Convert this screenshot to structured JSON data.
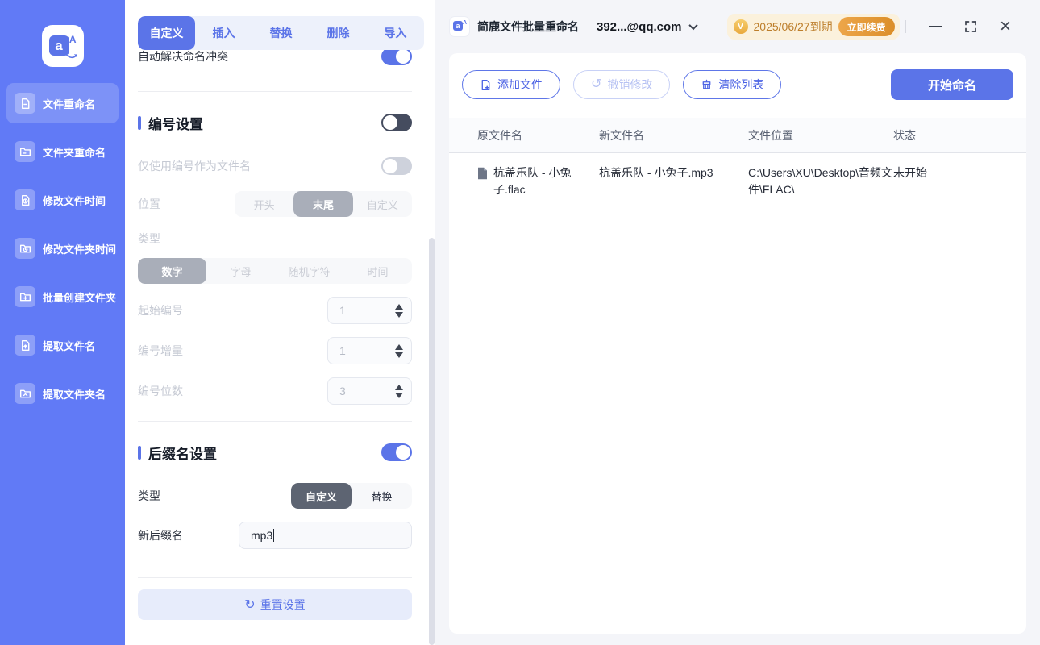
{
  "sidebar": {
    "items": [
      {
        "label": "文件重命名"
      },
      {
        "label": "文件夹重命名"
      },
      {
        "label": "修改文件时间"
      },
      {
        "label": "修改文件夹时间"
      },
      {
        "label": "批量创建文件夹"
      },
      {
        "label": "提取文件名"
      },
      {
        "label": "提取文件夹名"
      }
    ]
  },
  "tabs": [
    "自定义",
    "插入",
    "替换",
    "删除",
    "导入"
  ],
  "settings": {
    "conflict_label": "自动解决命名冲突",
    "conflict_on": true,
    "numbering": {
      "title": "编号设置",
      "enabled": false,
      "only_number_label": "仅使用编号作为文件名",
      "only_number_on": false,
      "position_label": "位置",
      "position_options": [
        "开头",
        "末尾",
        "自定义"
      ],
      "position_selected": "末尾",
      "type_label": "类型",
      "type_options": [
        "数字",
        "字母",
        "随机字符",
        "时间"
      ],
      "type_selected": "数字",
      "start_label": "起始编号",
      "start_value": "1",
      "increment_label": "编号增量",
      "increment_value": "1",
      "digits_label": "编号位数",
      "digits_value": "3"
    },
    "suffix": {
      "title": "后缀名设置",
      "enabled": true,
      "type_label": "类型",
      "type_options": [
        "自定义",
        "替换"
      ],
      "type_selected": "自定义",
      "new_suffix_label": "新后缀名",
      "new_suffix_value": "mp3"
    },
    "reset_label": "重置设置"
  },
  "titlebar": {
    "app_title": "简鹿文件批量重命名",
    "account": "392...@qq.com",
    "license_expiry": "2025/06/27到期",
    "renew_label": "立即续费"
  },
  "toolbar": {
    "add_files": "添加文件",
    "undo": "撤销修改",
    "clear_list": "清除列表",
    "start": "开始命名"
  },
  "table": {
    "headers": [
      "原文件名",
      "新文件名",
      "文件位置",
      "状态"
    ],
    "rows": [
      {
        "original": "杭盖乐队 - 小兔子.flac",
        "new_name": "杭盖乐队 - 小兔子.mp3",
        "location": "C:\\Users\\XU\\Desktop\\音频文件\\FLAC\\",
        "status": "未开始"
      }
    ]
  },
  "colors": {
    "accent": "#5b74e8",
    "sidebar": "#617af6",
    "warning_text": "#bd7e2b",
    "renew_orange": "#db8e28"
  }
}
